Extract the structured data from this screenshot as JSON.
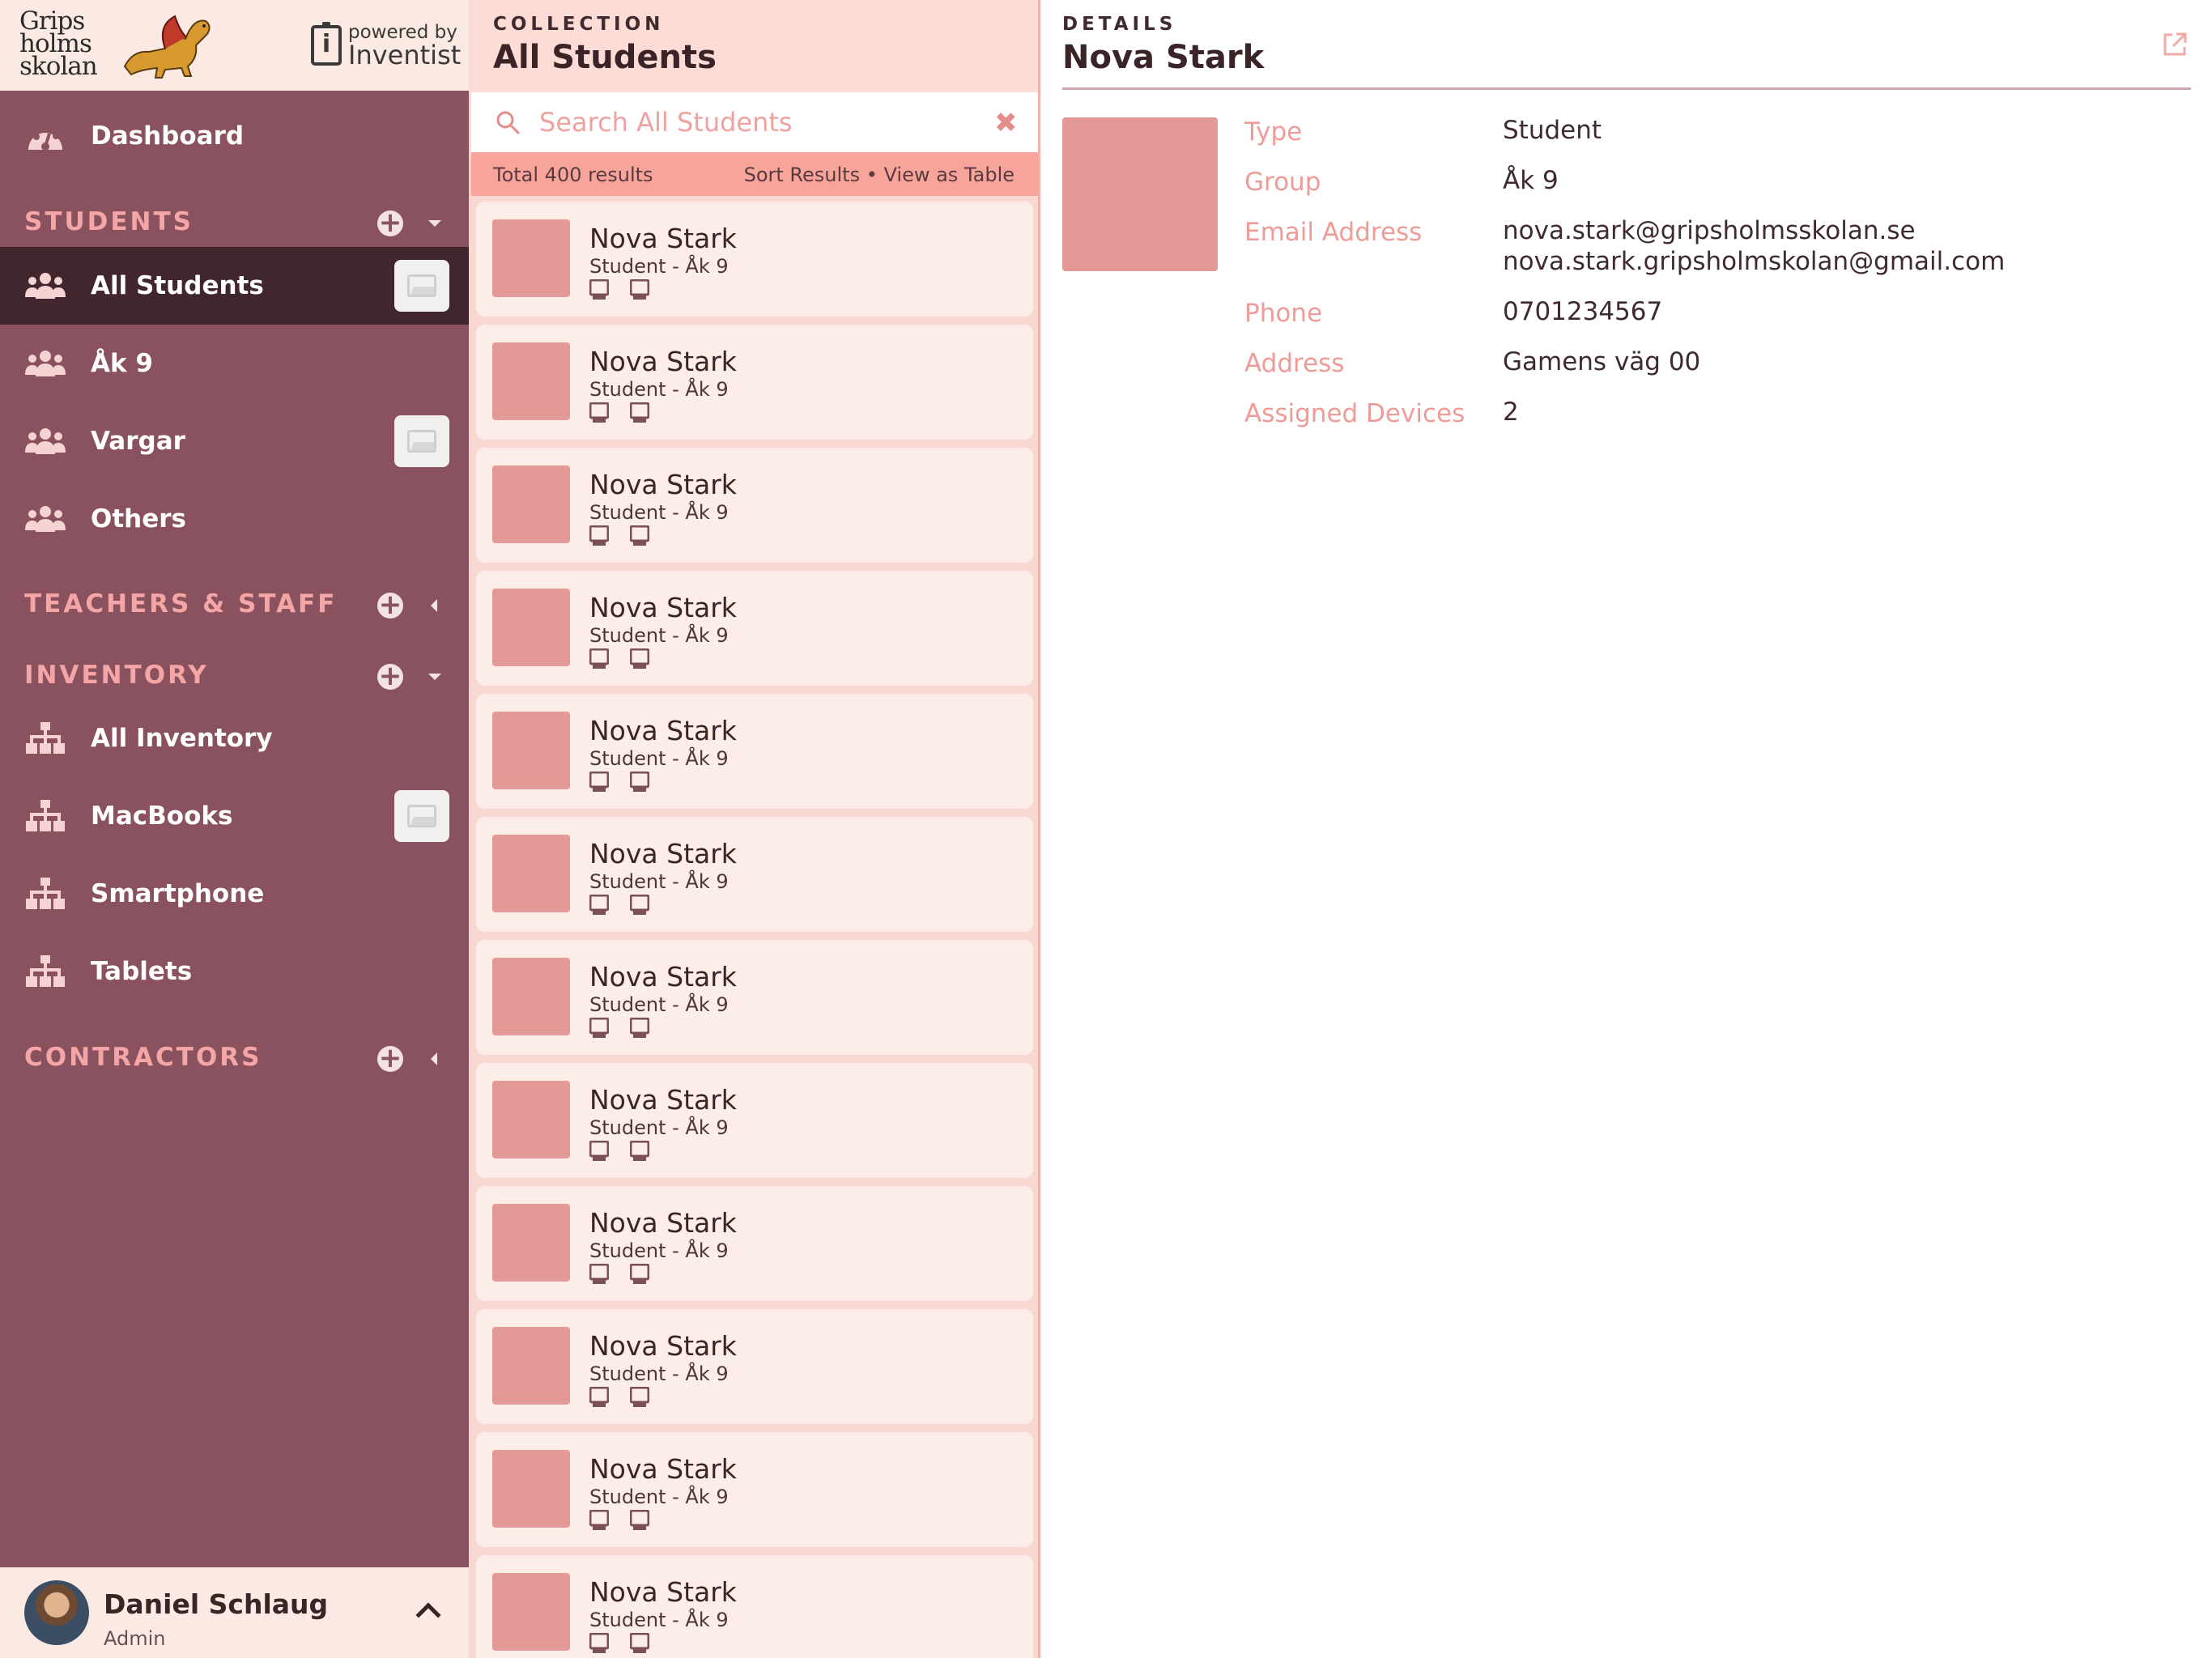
{
  "brand": {
    "school_name": [
      "Grips",
      "holms",
      "skolan"
    ],
    "powered_by": "powered by",
    "product": "Inventist"
  },
  "sidebar": {
    "dashboard": "Dashboard",
    "sections": {
      "students": "STUDENTS",
      "teachers": "TEACHERS & STAFF",
      "inventory": "INVENTORY",
      "contractors": "CONTRACTORS"
    },
    "student_items": [
      {
        "label": "All Students",
        "active": true,
        "has_image": true
      },
      {
        "label": "Åk 9",
        "active": false,
        "has_image": false
      },
      {
        "label": "Vargar",
        "active": false,
        "has_image": true
      },
      {
        "label": "Others",
        "active": false,
        "has_image": false
      }
    ],
    "inventory_items": [
      {
        "label": "All Inventory",
        "has_image": false
      },
      {
        "label": "MacBooks",
        "has_image": true
      },
      {
        "label": "Smartphone",
        "has_image": false
      },
      {
        "label": "Tablets",
        "has_image": false
      }
    ],
    "user": {
      "name": "Daniel Schlaug",
      "role": "Admin"
    }
  },
  "collection": {
    "eyebrow": "COLLECTION",
    "title": "All Students",
    "search_placeholder": "Search All Students",
    "total": "Total 400 results",
    "sort": "Sort Results",
    "separator": " • ",
    "view_table": "View as Table",
    "cards": [
      {
        "name": "Nova Stark",
        "subtitle": "Student - Åk 9",
        "devices": 2
      },
      {
        "name": "Nova Stark",
        "subtitle": "Student - Åk 9",
        "devices": 2
      },
      {
        "name": "Nova Stark",
        "subtitle": "Student - Åk 9",
        "devices": 2
      },
      {
        "name": "Nova Stark",
        "subtitle": "Student - Åk 9",
        "devices": 2
      },
      {
        "name": "Nova Stark",
        "subtitle": "Student - Åk 9",
        "devices": 2
      },
      {
        "name": "Nova Stark",
        "subtitle": "Student - Åk 9",
        "devices": 2
      },
      {
        "name": "Nova Stark",
        "subtitle": "Student - Åk 9",
        "devices": 2
      },
      {
        "name": "Nova Stark",
        "subtitle": "Student - Åk 9",
        "devices": 2
      },
      {
        "name": "Nova Stark",
        "subtitle": "Student - Åk 9",
        "devices": 2
      },
      {
        "name": "Nova Stark",
        "subtitle": "Student - Åk 9",
        "devices": 2
      },
      {
        "name": "Nova Stark",
        "subtitle": "Student - Åk 9",
        "devices": 2
      },
      {
        "name": "Nova Stark",
        "subtitle": "Student - Åk 9",
        "devices": 2
      }
    ]
  },
  "details": {
    "eyebrow": "DETAILS",
    "title": "Nova Stark",
    "fields": [
      {
        "label": "Type",
        "values": [
          "Student"
        ]
      },
      {
        "label": "Group",
        "values": [
          "Åk 9"
        ]
      },
      {
        "label": "Email Address",
        "values": [
          "nova.stark@gripsholmsskolan.se",
          "nova.stark.gripsholmskolan@gmail.com"
        ]
      },
      {
        "label": "Phone",
        "values": [
          "0701234567"
        ]
      },
      {
        "label": "Address",
        "values": [
          "Gamens väg 00"
        ]
      },
      {
        "label": "Assigned Devices",
        "values": [
          "2"
        ]
      }
    ]
  },
  "colors": {
    "sidebar": "#8a525e",
    "sidebar_active": "#41262d",
    "section_label": "#f4a5a5",
    "collection_bg": "#fad8d2",
    "card_bg": "#fdede8",
    "photo": "#e39a97",
    "results_bar": "#f7a59b",
    "field_label": "#ef9b98"
  },
  "icons": {
    "dashboard": "palette-icon",
    "group": "users-group-icon",
    "inventory": "sitemap-icon",
    "device": "device-icon",
    "search": "search-icon",
    "clear": "close-icon",
    "external": "external-link-icon",
    "thumbnail": "image-placeholder-icon"
  }
}
